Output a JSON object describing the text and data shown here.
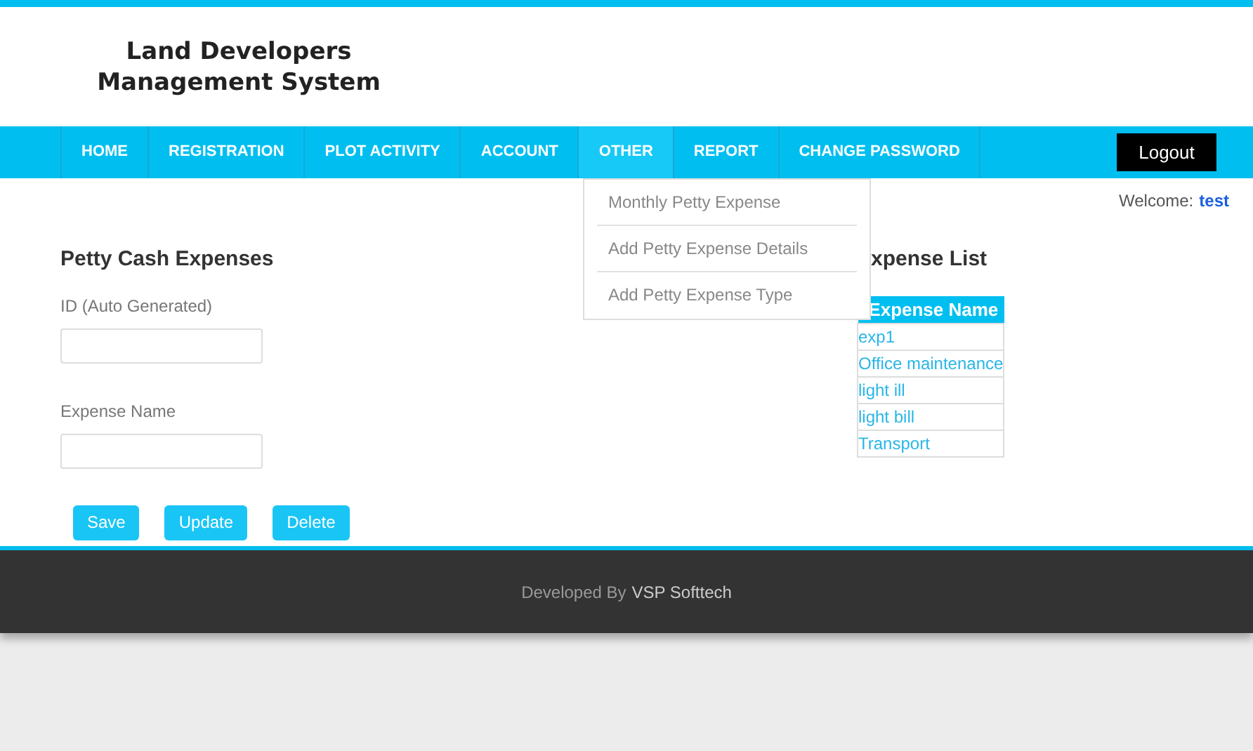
{
  "logo": {
    "line_1": "Land Developers",
    "line_2": "Management System"
  },
  "nav": [
    {
      "label": "HOME",
      "selected": false
    },
    {
      "label": "REGISTRATION",
      "selected": false
    },
    {
      "label": "PLOT ACTIVITY",
      "selected": false
    },
    {
      "label": "ACCOUNT",
      "selected": false
    },
    {
      "label": "OTHER",
      "selected": true
    },
    {
      "label": "REPORT",
      "selected": false
    },
    {
      "label": "CHANGE PASSWORD",
      "selected": false
    }
  ],
  "logout": "Logout",
  "welcome": {
    "label": "Welcome:",
    "user": "test"
  },
  "dropdown": [
    "Monthly Petty Expense",
    "Add Petty Expense Details",
    "Add Petty Expense Type"
  ],
  "form": {
    "title": "Petty Cash Expenses",
    "fields": [
      {
        "label": "ID (Auto Generated)"
      },
      {
        "label": "Expense Name"
      }
    ],
    "buttons": [
      "Save",
      "Update",
      "Delete"
    ]
  },
  "list": {
    "title": "xpense List",
    "column": "Expense Name",
    "rows": [
      "exp1",
      "Office maintenance",
      "light ill",
      "light bill",
      "Transport"
    ]
  },
  "footer": {
    "text": "Developed By",
    "brand": "VSP Softtech"
  }
}
